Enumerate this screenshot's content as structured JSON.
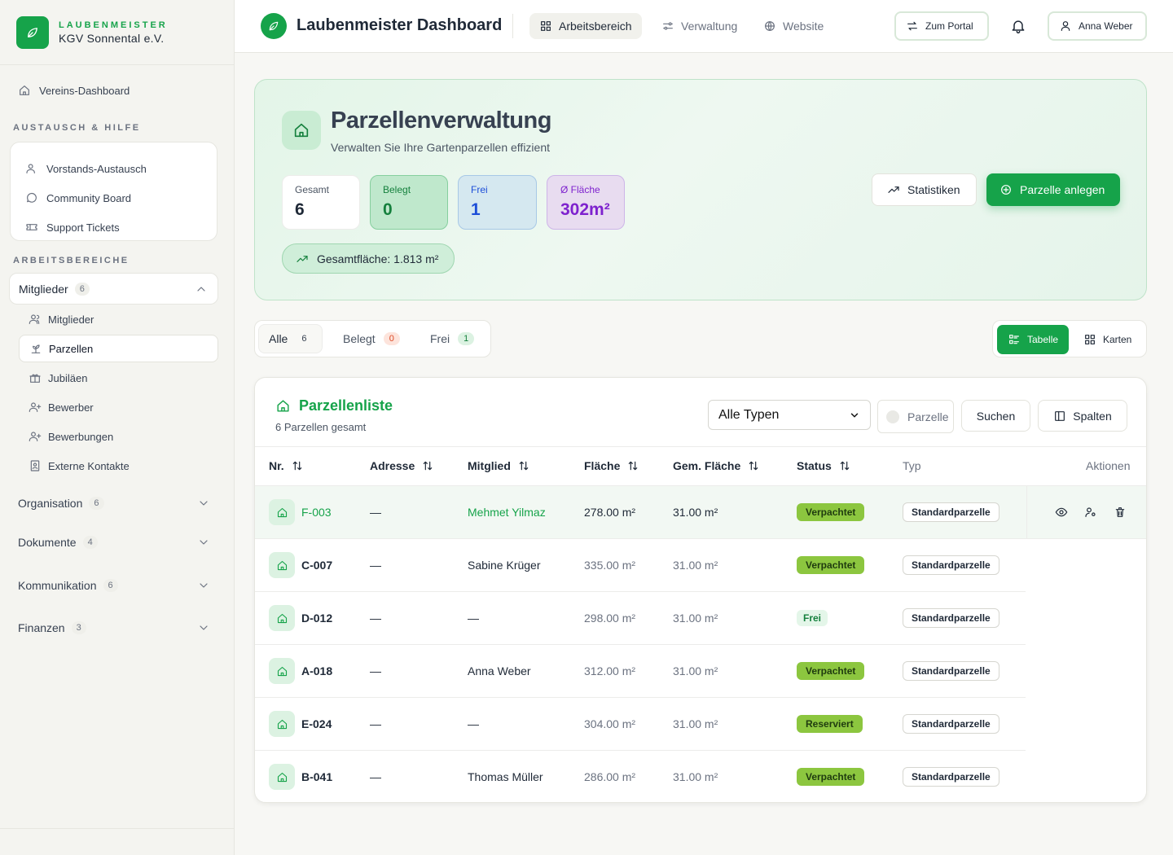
{
  "brand": {
    "small": "LAUBENMEISTER",
    "name": "KGV Sonnental e.V."
  },
  "sidebar": {
    "dashboard": "Vereins-Dashboard",
    "help_section": "AUSTAUSCH & HILFE",
    "help_items": [
      "Vorstands-Austausch",
      "Community Board",
      "Support Tickets"
    ],
    "work_section": "ARBEITSBEREICHE",
    "group": {
      "label": "Mitglieder",
      "count": "6"
    },
    "sub_items": [
      "Mitglieder",
      "Parzellen",
      "Jubiläen",
      "Bewerber",
      "Bewerbungen",
      "Externe Kontakte"
    ],
    "collapsed": [
      {
        "label": "Organisation",
        "count": "6"
      },
      {
        "label": "Dokumente",
        "count": "4"
      },
      {
        "label": "Kommunikation",
        "count": "6"
      },
      {
        "label": "Finanzen",
        "count": "3"
      }
    ]
  },
  "topbar": {
    "title": "Laubenmeister Dashboard",
    "nav": [
      "Arbeitsbereich",
      "Verwaltung",
      "Website"
    ],
    "portal": "Zum Portal",
    "user": "Anna Weber"
  },
  "hero": {
    "title": "Parzellenverwaltung",
    "subtitle": "Verwalten Sie Ihre Gartenparzellen effizient",
    "stats": [
      {
        "label": "Gesamt",
        "value": "6"
      },
      {
        "label": "Belegt",
        "value": "0"
      },
      {
        "label": "Frei",
        "value": "1"
      },
      {
        "label": "Ø Fläche",
        "value": "302m²"
      }
    ],
    "total_area": "Gesamtfläche: 1.813 m²",
    "stats_button": "Statistiken",
    "add_button": "Parzelle anlegen"
  },
  "filters": {
    "tabs": [
      {
        "label": "Alle",
        "count": "6"
      },
      {
        "label": "Belegt",
        "count": "0"
      },
      {
        "label": "Frei",
        "count": "1"
      }
    ],
    "view_table": "Tabelle",
    "view_cards": "Karten"
  },
  "table": {
    "title": "Parzellenliste",
    "subtitle": "6 Parzellen gesamt",
    "type_select": "Alle Typen",
    "search_placeholder": "Parzelle",
    "search_button": "Suchen",
    "columns_button": "Spalten",
    "headers": [
      "Nr.",
      "Adresse",
      "Mitglied",
      "Fläche",
      "Gem. Fläche",
      "Status",
      "Typ",
      "Aktionen"
    ],
    "rows": [
      {
        "nr": "F-003",
        "address": "—",
        "member": "Mehmet Yilmaz",
        "area": "278.00 m²",
        "common": "31.00 m²",
        "status": "Verpachtet",
        "type": "Standardparzelle"
      },
      {
        "nr": "C-007",
        "address": "—",
        "member": "Sabine Krüger",
        "area": "335.00 m²",
        "common": "31.00 m²",
        "status": "Verpachtet",
        "type": "Standardparzelle"
      },
      {
        "nr": "D-012",
        "address": "—",
        "member": "—",
        "area": "298.00 m²",
        "common": "31.00 m²",
        "status": "Frei",
        "type": "Standardparzelle"
      },
      {
        "nr": "A-018",
        "address": "—",
        "member": "Anna Weber",
        "area": "312.00 m²",
        "common": "31.00 m²",
        "status": "Verpachtet",
        "type": "Standardparzelle"
      },
      {
        "nr": "E-024",
        "address": "—",
        "member": "—",
        "area": "304.00 m²",
        "common": "31.00 m²",
        "status": "Reserviert",
        "type": "Standardparzelle"
      },
      {
        "nr": "B-041",
        "address": "—",
        "member": "Thomas Müller",
        "area": "286.00 m²",
        "common": "31.00 m²",
        "status": "Verpachtet",
        "type": "Standardparzelle"
      }
    ]
  },
  "colors": {
    "accent": "#16a34a",
    "status_badge": "#8cc63f",
    "purple": "#7e22ce",
    "blue": "#1d4ed8"
  },
  "icons": [
    "leaf-icon",
    "home-icon",
    "users-icon",
    "chat-icon",
    "ticket-icon",
    "gift-icon",
    "user-plus-icon",
    "id-card-icon",
    "grid-icon",
    "sliders-icon",
    "globe-icon",
    "swap-icon",
    "bell-icon",
    "user-icon",
    "trend-icon",
    "plus-circle-icon",
    "list-icon",
    "columns-icon",
    "sort-icon",
    "eye-icon",
    "user-key-icon",
    "trash-icon",
    "chevron-down-icon",
    "chevron-up-icon"
  ]
}
